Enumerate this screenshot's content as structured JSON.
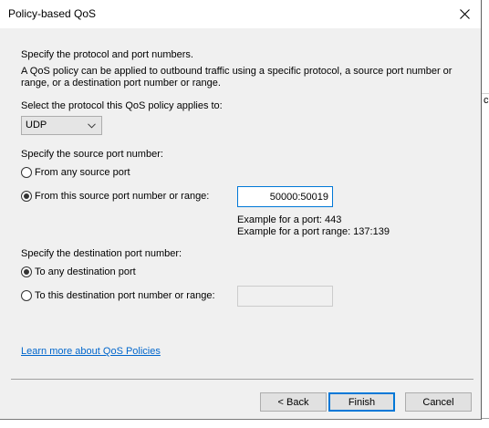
{
  "window": {
    "title": "Policy-based QoS"
  },
  "background": {
    "edge_text": "c"
  },
  "intro": {
    "heading": "Specify the protocol and port numbers.",
    "description_line1": "A QoS policy can be applied to outbound traffic using a specific protocol, a source port number or",
    "description_line2": "range, or a destination port number or range."
  },
  "protocol": {
    "label": "Select the protocol this QoS policy applies to:",
    "selected": "UDP"
  },
  "source": {
    "label": "Specify the source port number:",
    "option_any": "From any source port",
    "option_specific": "From this source port number or range:",
    "selected": "specific",
    "value": "50000:50019",
    "example_port": "Example for a port: 443",
    "example_range": "Example for a port range: 137:139"
  },
  "destination": {
    "label": "Specify the destination port number:",
    "option_any": "To any destination port",
    "option_specific": "To this destination port number or range:",
    "selected": "any",
    "value": ""
  },
  "link": {
    "text": "Learn more about QoS Policies"
  },
  "buttons": {
    "back": "< Back",
    "finish": "Finish",
    "cancel": "Cancel"
  },
  "colors": {
    "accent": "#0078d7",
    "link": "#0066cc",
    "dialog_bg": "#f0f0f0"
  }
}
